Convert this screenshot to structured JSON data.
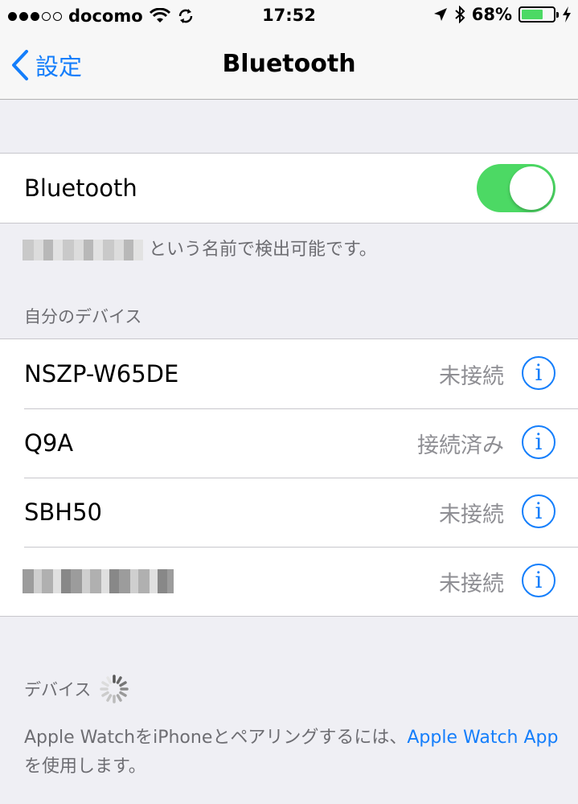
{
  "status_bar": {
    "carrier": "docomo",
    "time": "17:52",
    "battery_percent": "68%",
    "battery_level": 0.68
  },
  "nav": {
    "back_label": "設定",
    "title": "Bluetooth"
  },
  "bluetooth_toggle": {
    "label": "Bluetooth",
    "on": true
  },
  "discoverable_text": "という名前で検出可能です。",
  "my_devices": {
    "header": "自分のデバイス",
    "items": [
      {
        "name": "NSZP-W65DE",
        "status": "未接続"
      },
      {
        "name": "Q9A",
        "status": "接続済み"
      },
      {
        "name": "SBH50",
        "status": "未接続"
      },
      {
        "name": "",
        "status": "未接続"
      }
    ]
  },
  "devices": {
    "header": "デバイス"
  },
  "apple_watch": {
    "text_before": "Apple WatchをiPhoneとペアリングするには、",
    "link": "Apple Watch App",
    "text_after": "を使用します。"
  },
  "colors": {
    "accent": "#147efb",
    "toggle_on": "#4cd964",
    "background": "#efeff4"
  }
}
